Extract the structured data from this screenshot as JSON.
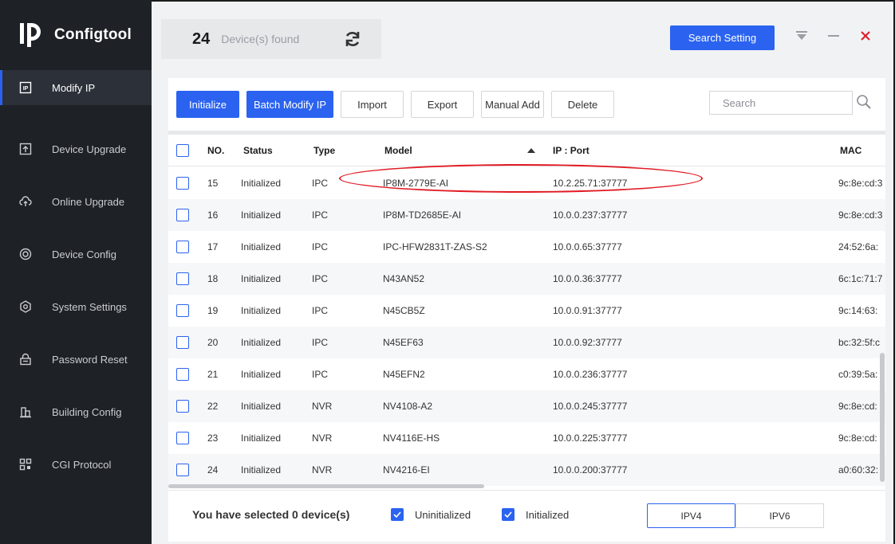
{
  "app": {
    "name": "Configtool"
  },
  "sidebar": {
    "items": [
      {
        "label": "Modify IP",
        "icon": "ip-icon"
      },
      {
        "label": "Device Upgrade",
        "icon": "upload-icon"
      },
      {
        "label": "Online Upgrade",
        "icon": "cloud-upload-icon"
      },
      {
        "label": "Device Config",
        "icon": "target-icon"
      },
      {
        "label": "System Settings",
        "icon": "gear-icon"
      },
      {
        "label": "Password Reset",
        "icon": "lock-icon"
      },
      {
        "label": "Building Config",
        "icon": "building-icon"
      },
      {
        "label": "CGI Protocol",
        "icon": "qr-icon"
      }
    ]
  },
  "header": {
    "count": "24",
    "count_label": "Device(s) found",
    "search_setting_label": "Search Setting"
  },
  "toolbar": {
    "initialize": "Initialize",
    "batch_modify": "Batch Modify IP",
    "import": "Import",
    "export": "Export",
    "manual_add": "Manual Add",
    "delete": "Delete",
    "search_placeholder": "Search"
  },
  "table": {
    "columns": [
      "NO.",
      "Status",
      "Type",
      "Model",
      "IP : Port",
      "MAC"
    ],
    "rows": [
      {
        "no": "15",
        "status": "Initialized",
        "type": "IPC",
        "model": "IP8M-2779E-AI",
        "ip": "10.2.25.71:37777",
        "mac": "9c:8e:cd:3"
      },
      {
        "no": "16",
        "status": "Initialized",
        "type": "IPC",
        "model": "IP8M-TD2685E-AI",
        "ip": "10.0.0.237:37777",
        "mac": "9c:8e:cd:3"
      },
      {
        "no": "17",
        "status": "Initialized",
        "type": "IPC",
        "model": "IPC-HFW2831T-ZAS-S2",
        "ip": "10.0.0.65:37777",
        "mac": "24:52:6a:"
      },
      {
        "no": "18",
        "status": "Initialized",
        "type": "IPC",
        "model": "N43AN52",
        "ip": "10.0.0.36:37777",
        "mac": "6c:1c:71:7"
      },
      {
        "no": "19",
        "status": "Initialized",
        "type": "IPC",
        "model": "N45CB5Z",
        "ip": "10.0.0.91:37777",
        "mac": "9c:14:63:"
      },
      {
        "no": "20",
        "status": "Initialized",
        "type": "IPC",
        "model": "N45EF63",
        "ip": "10.0.0.92:37777",
        "mac": "bc:32:5f:c"
      },
      {
        "no": "21",
        "status": "Initialized",
        "type": "IPC",
        "model": "N45EFN2",
        "ip": "10.0.0.236:37777",
        "mac": "c0:39:5a:"
      },
      {
        "no": "22",
        "status": "Initialized",
        "type": "NVR",
        "model": "NV4108-A2",
        "ip": "10.0.0.245:37777",
        "mac": "9c:8e:cd:"
      },
      {
        "no": "23",
        "status": "Initialized",
        "type": "NVR",
        "model": "NV4116E-HS",
        "ip": "10.0.0.225:37777",
        "mac": "9c:8e:cd:"
      },
      {
        "no": "24",
        "status": "Initialized",
        "type": "NVR",
        "model": "NV4216-EI",
        "ip": "10.0.0.200:37777",
        "mac": "a0:60:32:"
      }
    ]
  },
  "footer": {
    "selected_text": "You have selected 0  device(s)",
    "filter_uninitialized": "Uninitialized",
    "filter_initialized": "Initialized",
    "ipv4": "IPV4",
    "ipv6": "IPV6"
  },
  "colors": {
    "accent": "#2b63f0",
    "sidebar_bg": "#1e2126",
    "highlight": "#e01b24"
  }
}
